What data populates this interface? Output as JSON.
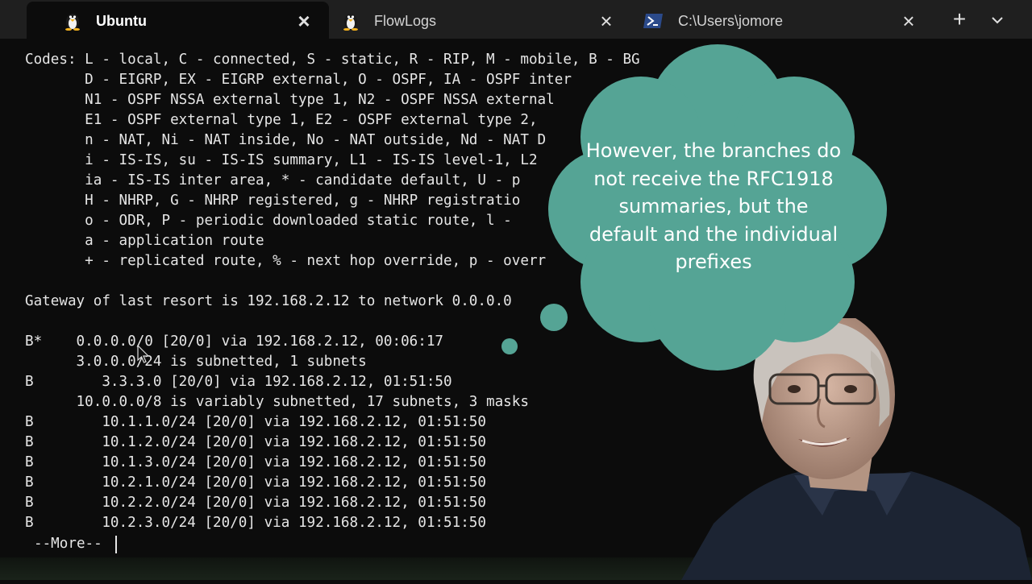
{
  "tabs": [
    {
      "label": "Ubuntu",
      "icon": "linux-penguin-icon",
      "active": true
    },
    {
      "label": "FlowLogs",
      "icon": "linux-penguin-icon",
      "active": false
    },
    {
      "label": "C:\\Users\\jomore",
      "icon": "powershell-icon",
      "active": false
    }
  ],
  "terminal": {
    "lines": [
      "Codes: L - local, C - connected, S - static, R - RIP, M - mobile, B - BG",
      "       D - EIGRP, EX - EIGRP external, O - OSPF, IA - OSPF inter",
      "       N1 - OSPF NSSA external type 1, N2 - OSPF NSSA external",
      "       E1 - OSPF external type 1, E2 - OSPF external type 2,",
      "       n - NAT, Ni - NAT inside, No - NAT outside, Nd - NAT D",
      "       i - IS-IS, su - IS-IS summary, L1 - IS-IS level-1, L2",
      "       ia - IS-IS inter area, * - candidate default, U - p",
      "       H - NHRP, G - NHRP registered, g - NHRP registratio",
      "       o - ODR, P - periodic downloaded static route, l -",
      "       a - application route",
      "       + - replicated route, % - next hop override, p - overr",
      "",
      "Gateway of last resort is 192.168.2.12 to network 0.0.0.0",
      "",
      "B*    0.0.0.0/0 [20/0] via 192.168.2.12, 00:06:17",
      "      3.0.0.0/24 is subnetted, 1 subnets",
      "B        3.3.3.0 [20/0] via 192.168.2.12, 01:51:50",
      "      10.0.0.0/8 is variably subnetted, 17 subnets, 3 masks",
      "B        10.1.1.0/24 [20/0] via 192.168.2.12, 01:51:50",
      "B        10.1.2.0/24 [20/0] via 192.168.2.12, 01:51:50",
      "B        10.1.3.0/24 [20/0] via 192.168.2.12, 01:51:50",
      "B        10.2.1.0/24 [20/0] via 192.168.2.12, 01:51:50",
      "B        10.2.2.0/24 [20/0] via 192.168.2.12, 01:51:50",
      "B        10.2.3.0/24 [20/0] via 192.168.2.12, 01:51:50"
    ],
    "more_prompt": "--More--"
  },
  "thought_bubble": {
    "text": "However, the branches do not receive the RFC1918 summaries, but the default and the individual prefixes"
  },
  "colors": {
    "tabbar_bg": "#1f1f1f",
    "terminal_bg": "#0c0c0c",
    "terminal_fg": "#e6e6e6",
    "bubble": "#55a495"
  }
}
